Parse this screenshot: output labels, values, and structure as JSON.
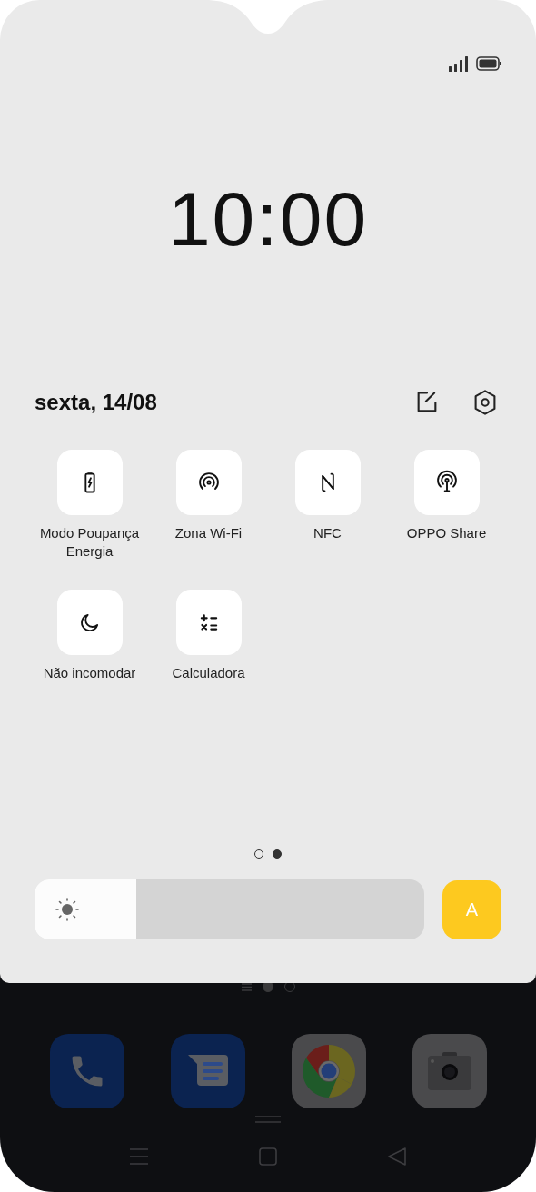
{
  "lock_panel": {
    "time": "10:00",
    "date": "sexta, 14/08"
  },
  "quick_tiles": [
    {
      "kind": "battery",
      "label": "Modo Poupança Energia"
    },
    {
      "kind": "hotspot",
      "label": "Zona Wi-Fi"
    },
    {
      "kind": "nfc",
      "label": "NFC"
    },
    {
      "kind": "share",
      "label": "OPPO Share"
    },
    {
      "kind": "moon",
      "label": "Não incomodar"
    },
    {
      "kind": "calculator",
      "label": "Calculadora"
    }
  ],
  "pager": [
    {
      "selected": false
    },
    {
      "selected": true
    }
  ],
  "brightness": {
    "level": 0.26
  },
  "auto_brightness": {
    "label": "A",
    "on": true
  },
  "home_pager": [
    {
      "selected": true
    },
    {
      "selected": false
    }
  ],
  "dock": [
    {
      "kind": "phone"
    },
    {
      "kind": "messages"
    },
    {
      "kind": "browser"
    },
    {
      "kind": "camera"
    }
  ]
}
